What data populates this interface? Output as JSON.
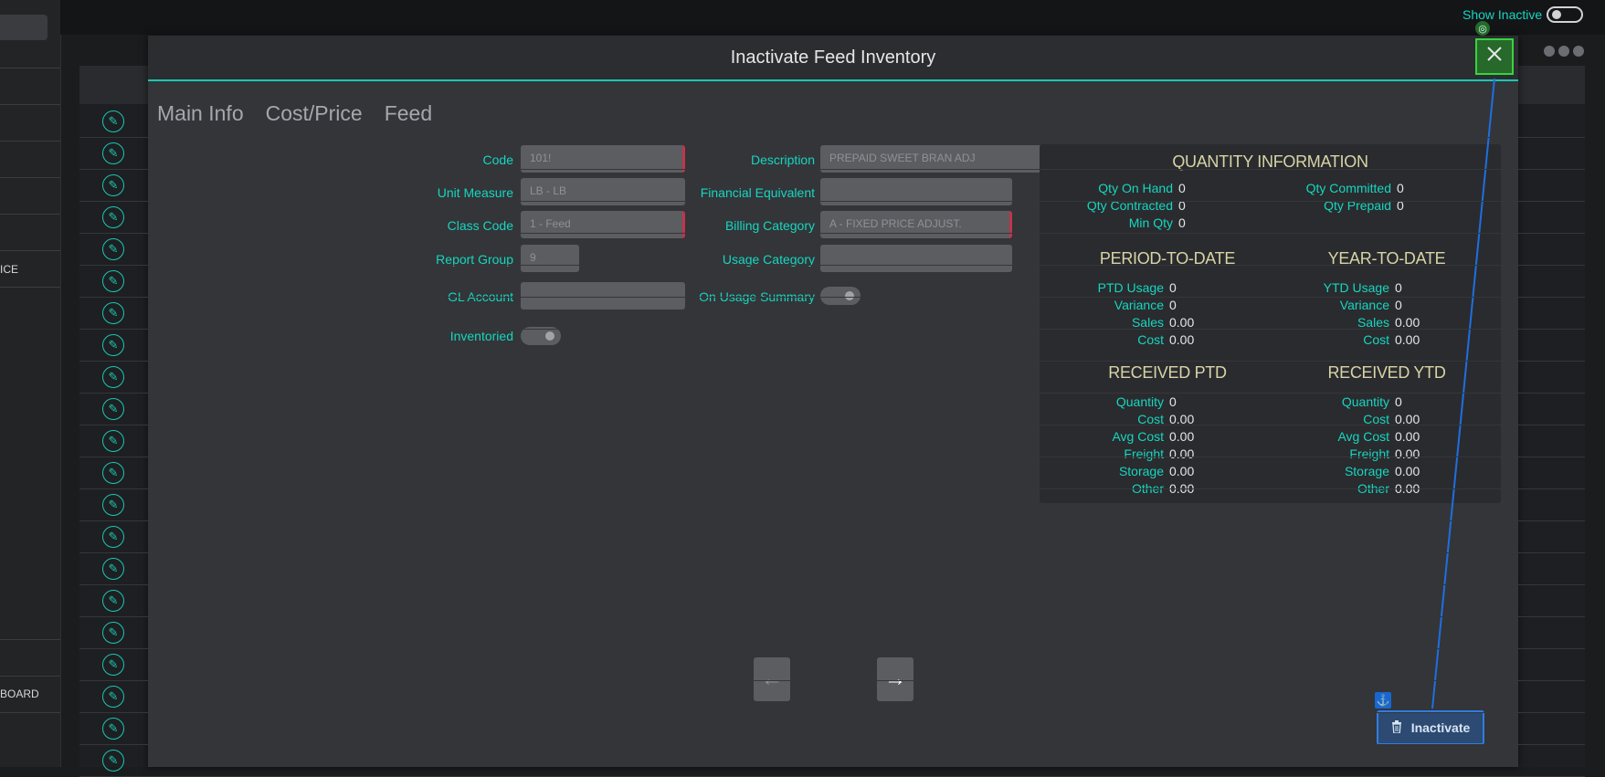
{
  "background": {
    "nav_items": [
      {
        "label": "ICE"
      },
      {
        "label": "BOARD"
      }
    ],
    "show_inactive_label": "Show Inactive",
    "more_icon": "ellipsis-icon",
    "edit_icon": "pencil-icon"
  },
  "modal": {
    "title": "Inactivate Feed Inventory",
    "close_icon": "close-icon",
    "tabs": [
      {
        "label": "Main Info"
      },
      {
        "label": "Cost/Price"
      },
      {
        "label": "Feed"
      }
    ],
    "form": {
      "code": {
        "label": "Code",
        "value": "101!"
      },
      "unit_measure": {
        "label": "Unit Measure",
        "value": "LB - LB"
      },
      "class_code": {
        "label": "Class Code",
        "value": "1 - Feed"
      },
      "report_group": {
        "label": "Report Group",
        "value": "9"
      },
      "gl_account": {
        "label": "GL Account",
        "value": ""
      },
      "inventoried": {
        "label": "Inventoried"
      },
      "description": {
        "label": "Description",
        "value": "PREPAID SWEET BRAN ADJ"
      },
      "financial_equivalent": {
        "label": "Financial Equivalent",
        "value": ""
      },
      "billing_category": {
        "label": "Billing Category",
        "value": "A - FIXED PRICE ADJUST."
      },
      "usage_category": {
        "label": "Usage Category",
        "value": ""
      },
      "on_usage_summary": {
        "label": "On Usage Summary"
      }
    },
    "quantity": {
      "title": "QUANTITY INFORMATION",
      "qty_on_hand": {
        "label": "Qty On Hand",
        "value": "0"
      },
      "qty_contracted": {
        "label": "Qty Contracted",
        "value": "0"
      },
      "min_qty": {
        "label": "Min Qty",
        "value": "0"
      },
      "qty_committed": {
        "label": "Qty Committed",
        "value": "0"
      },
      "qty_prepaid": {
        "label": "Qty Prepaid",
        "value": "0"
      },
      "ptd": {
        "title": "PERIOD-TO-DATE",
        "rows": [
          {
            "label": "PTD Usage",
            "value": "0"
          },
          {
            "label": "Variance",
            "value": "0"
          },
          {
            "label": "Sales",
            "value": "0.00"
          },
          {
            "label": "Cost",
            "value": "0.00"
          }
        ]
      },
      "ytd": {
        "title": "YEAR-TO-DATE",
        "rows": [
          {
            "label": "YTD Usage",
            "value": "0"
          },
          {
            "label": "Variance",
            "value": "0"
          },
          {
            "label": "Sales",
            "value": "0.00"
          },
          {
            "label": "Cost",
            "value": "0.00"
          }
        ]
      },
      "received_ptd": {
        "title": "RECEIVED PTD",
        "rows": [
          {
            "label": "Quantity",
            "value": "0"
          },
          {
            "label": "Cost",
            "value": "0.00"
          },
          {
            "label": "Avg Cost",
            "value": "0.00"
          },
          {
            "label": "Freight",
            "value": "0.00"
          },
          {
            "label": "Storage",
            "value": "0.00"
          },
          {
            "label": "Other",
            "value": "0.00"
          }
        ]
      },
      "received_ytd": {
        "title": "RECEIVED YTD",
        "rows": [
          {
            "label": "Quantity",
            "value": "0"
          },
          {
            "label": "Cost",
            "value": "0.00"
          },
          {
            "label": "Avg Cost",
            "value": "0.00"
          },
          {
            "label": "Freight",
            "value": "0.00"
          },
          {
            "label": "Storage",
            "value": "0.00"
          },
          {
            "label": "Other",
            "value": "0.00"
          }
        ]
      }
    },
    "prev_icon": "arrow-left-icon",
    "next_icon": "arrow-right-icon",
    "inactivate_label": "Inactivate",
    "inactivate_icon": "trash-icon"
  },
  "colors": {
    "accent": "#16d6c0",
    "required": "#c2344c",
    "primary_button": "#2c4a72"
  }
}
